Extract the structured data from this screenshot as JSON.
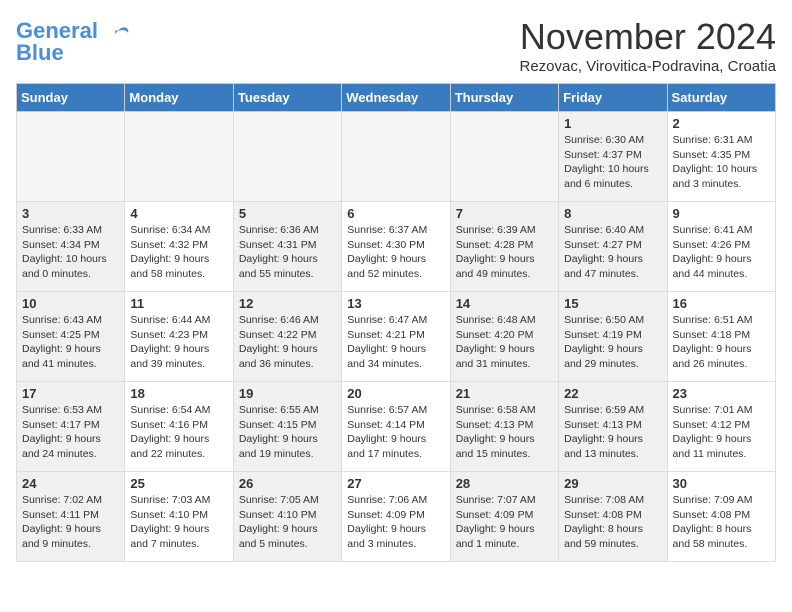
{
  "header": {
    "logo_general": "General",
    "logo_blue": "Blue",
    "title": "November 2024",
    "location": "Rezovac, Virovitica-Podravina, Croatia"
  },
  "days_of_week": [
    "Sunday",
    "Monday",
    "Tuesday",
    "Wednesday",
    "Thursday",
    "Friday",
    "Saturday"
  ],
  "weeks": [
    [
      {
        "day": "",
        "info": "",
        "empty": true
      },
      {
        "day": "",
        "info": "",
        "empty": true
      },
      {
        "day": "",
        "info": "",
        "empty": true
      },
      {
        "day": "",
        "info": "",
        "empty": true
      },
      {
        "day": "",
        "info": "",
        "empty": true
      },
      {
        "day": "1",
        "info": "Sunrise: 6:30 AM\nSunset: 4:37 PM\nDaylight: 10 hours and 6 minutes.",
        "shaded": true
      },
      {
        "day": "2",
        "info": "Sunrise: 6:31 AM\nSunset: 4:35 PM\nDaylight: 10 hours and 3 minutes."
      }
    ],
    [
      {
        "day": "3",
        "info": "Sunrise: 6:33 AM\nSunset: 4:34 PM\nDaylight: 10 hours and 0 minutes.",
        "shaded": true
      },
      {
        "day": "4",
        "info": "Sunrise: 6:34 AM\nSunset: 4:32 PM\nDaylight: 9 hours and 58 minutes."
      },
      {
        "day": "5",
        "info": "Sunrise: 6:36 AM\nSunset: 4:31 PM\nDaylight: 9 hours and 55 minutes.",
        "shaded": true
      },
      {
        "day": "6",
        "info": "Sunrise: 6:37 AM\nSunset: 4:30 PM\nDaylight: 9 hours and 52 minutes."
      },
      {
        "day": "7",
        "info": "Sunrise: 6:39 AM\nSunset: 4:28 PM\nDaylight: 9 hours and 49 minutes.",
        "shaded": true
      },
      {
        "day": "8",
        "info": "Sunrise: 6:40 AM\nSunset: 4:27 PM\nDaylight: 9 hours and 47 minutes.",
        "shaded": true
      },
      {
        "day": "9",
        "info": "Sunrise: 6:41 AM\nSunset: 4:26 PM\nDaylight: 9 hours and 44 minutes."
      }
    ],
    [
      {
        "day": "10",
        "info": "Sunrise: 6:43 AM\nSunset: 4:25 PM\nDaylight: 9 hours and 41 minutes.",
        "shaded": true
      },
      {
        "day": "11",
        "info": "Sunrise: 6:44 AM\nSunset: 4:23 PM\nDaylight: 9 hours and 39 minutes."
      },
      {
        "day": "12",
        "info": "Sunrise: 6:46 AM\nSunset: 4:22 PM\nDaylight: 9 hours and 36 minutes.",
        "shaded": true
      },
      {
        "day": "13",
        "info": "Sunrise: 6:47 AM\nSunset: 4:21 PM\nDaylight: 9 hours and 34 minutes."
      },
      {
        "day": "14",
        "info": "Sunrise: 6:48 AM\nSunset: 4:20 PM\nDaylight: 9 hours and 31 minutes.",
        "shaded": true
      },
      {
        "day": "15",
        "info": "Sunrise: 6:50 AM\nSunset: 4:19 PM\nDaylight: 9 hours and 29 minutes.",
        "shaded": true
      },
      {
        "day": "16",
        "info": "Sunrise: 6:51 AM\nSunset: 4:18 PM\nDaylight: 9 hours and 26 minutes."
      }
    ],
    [
      {
        "day": "17",
        "info": "Sunrise: 6:53 AM\nSunset: 4:17 PM\nDaylight: 9 hours and 24 minutes.",
        "shaded": true
      },
      {
        "day": "18",
        "info": "Sunrise: 6:54 AM\nSunset: 4:16 PM\nDaylight: 9 hours and 22 minutes."
      },
      {
        "day": "19",
        "info": "Sunrise: 6:55 AM\nSunset: 4:15 PM\nDaylight: 9 hours and 19 minutes.",
        "shaded": true
      },
      {
        "day": "20",
        "info": "Sunrise: 6:57 AM\nSunset: 4:14 PM\nDaylight: 9 hours and 17 minutes."
      },
      {
        "day": "21",
        "info": "Sunrise: 6:58 AM\nSunset: 4:13 PM\nDaylight: 9 hours and 15 minutes.",
        "shaded": true
      },
      {
        "day": "22",
        "info": "Sunrise: 6:59 AM\nSunset: 4:13 PM\nDaylight: 9 hours and 13 minutes.",
        "shaded": true
      },
      {
        "day": "23",
        "info": "Sunrise: 7:01 AM\nSunset: 4:12 PM\nDaylight: 9 hours and 11 minutes."
      }
    ],
    [
      {
        "day": "24",
        "info": "Sunrise: 7:02 AM\nSunset: 4:11 PM\nDaylight: 9 hours and 9 minutes.",
        "shaded": true
      },
      {
        "day": "25",
        "info": "Sunrise: 7:03 AM\nSunset: 4:10 PM\nDaylight: 9 hours and 7 minutes."
      },
      {
        "day": "26",
        "info": "Sunrise: 7:05 AM\nSunset: 4:10 PM\nDaylight: 9 hours and 5 minutes.",
        "shaded": true
      },
      {
        "day": "27",
        "info": "Sunrise: 7:06 AM\nSunset: 4:09 PM\nDaylight: 9 hours and 3 minutes."
      },
      {
        "day": "28",
        "info": "Sunrise: 7:07 AM\nSunset: 4:09 PM\nDaylight: 9 hours and 1 minute.",
        "shaded": true
      },
      {
        "day": "29",
        "info": "Sunrise: 7:08 AM\nSunset: 4:08 PM\nDaylight: 8 hours and 59 minutes.",
        "shaded": true
      },
      {
        "day": "30",
        "info": "Sunrise: 7:09 AM\nSunset: 4:08 PM\nDaylight: 8 hours and 58 minutes."
      }
    ]
  ]
}
